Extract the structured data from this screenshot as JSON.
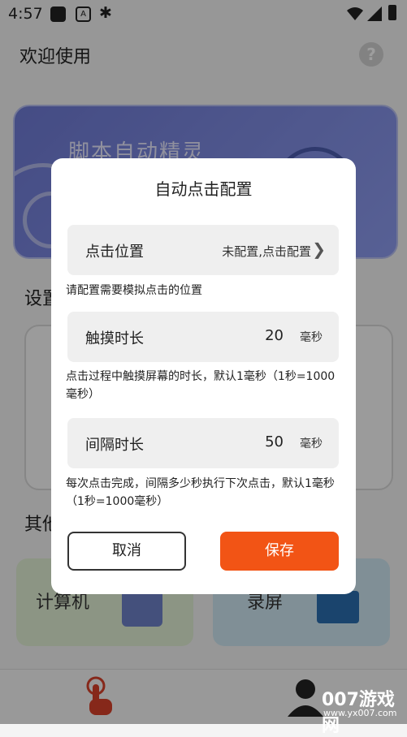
{
  "status_bar": {
    "time": "4:57"
  },
  "header": {
    "title": "欢迎使用",
    "help_icon": "question-circle-icon"
  },
  "banner": {
    "title": "脚本自动精灵"
  },
  "sections": {
    "settings_title": "设置",
    "other_title": "其他"
  },
  "tiles": [
    {
      "label": "计算机",
      "icon": "calculator-icon"
    },
    {
      "label": "录屏",
      "icon": "screen-record-icon"
    }
  ],
  "dialog": {
    "title": "自动点击配置",
    "position": {
      "label": "点击位置",
      "value": "未配置,点击配置",
      "hint": "请配置需要模拟点击的位置"
    },
    "touch_duration": {
      "label": "触摸时长",
      "value": "20",
      "unit": "毫秒",
      "hint": "点击过程中触摸屏幕的时长，默认1毫秒（1秒=1000毫秒）"
    },
    "interval": {
      "label": "间隔时长",
      "value": "50",
      "unit": "毫秒",
      "hint": "每次点击完成，间隔多少秒执行下次点击，默认1毫秒（1秒=1000毫秒）"
    },
    "cancel_label": "取消",
    "save_label": "保存"
  },
  "watermark": {
    "main": "007游戏网",
    "sub": "www.yx007.com"
  },
  "colors": {
    "accent": "#f25415",
    "banner": "#7f8be3"
  }
}
